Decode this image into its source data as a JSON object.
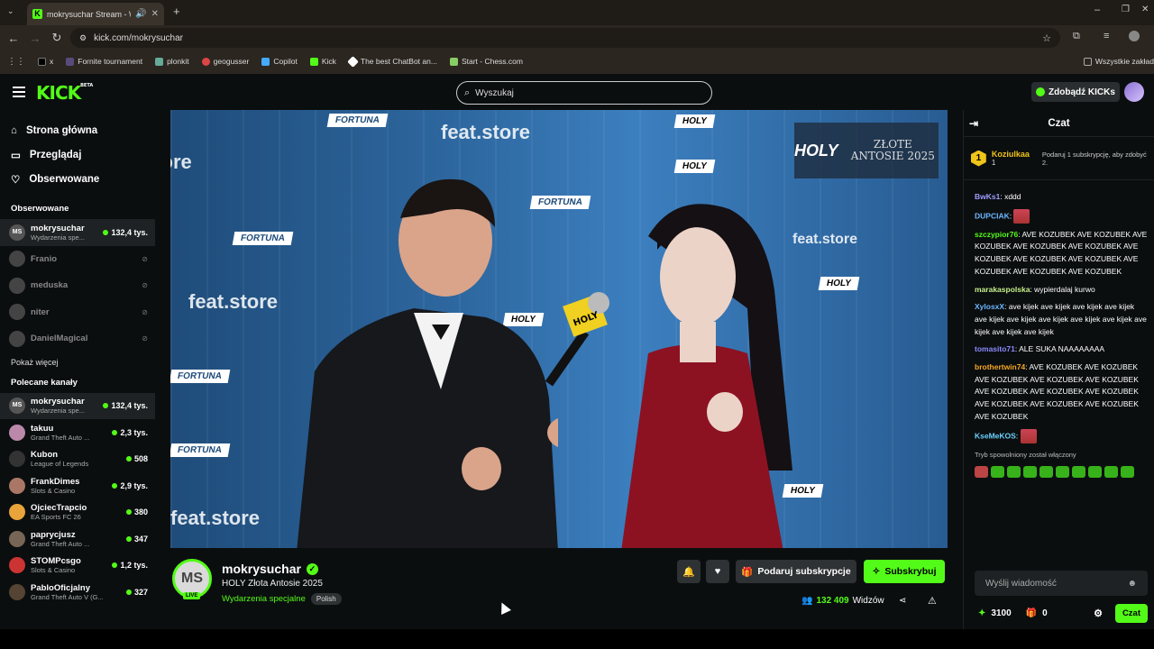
{
  "browser": {
    "tab_title": "mokrysuchar Stream - Wat",
    "url": "kick.com/mokrysuchar",
    "bookmarks": [
      "x",
      "Fornite tournament",
      "plonkit",
      "geogusser",
      "Copilot",
      "Kick",
      "The best ChatBot an...",
      "Start - Chess.com"
    ],
    "bookmarks_other": "Wszystkie zakład"
  },
  "header": {
    "logo": "KICK",
    "logo_beta": "BETA",
    "search_placeholder": "Wyszukaj",
    "kicks_button": "Zdobądź KICKs"
  },
  "sidebar": {
    "nav": [
      "Strona główna",
      "Przeglądaj",
      "Obserwowane"
    ],
    "followed_title": "Obserwowane",
    "followed": [
      {
        "name": "mokrysuchar",
        "category": "Wydarzenia spe...",
        "viewers": "132,4 tys.",
        "live": true
      },
      {
        "name": "Franio",
        "live": false
      },
      {
        "name": "meduska",
        "live": false
      },
      {
        "name": "niter",
        "live": false
      },
      {
        "name": "DanielMagical",
        "live": false
      }
    ],
    "show_more": "Pokaż więcej",
    "recommended_title": "Polecane kanały",
    "recommended": [
      {
        "name": "mokrysuchar",
        "category": "Wydarzenia spe...",
        "viewers": "132,4 tys."
      },
      {
        "name": "takuu",
        "category": "Grand Theft Auto ...",
        "viewers": "2,3 tys."
      },
      {
        "name": "Kubon",
        "category": "League of Legends",
        "viewers": "508"
      },
      {
        "name": "FrankDimes",
        "category": "Slots & Casino",
        "viewers": "2,9 tys."
      },
      {
        "name": "OjciecTrapcio",
        "category": "EA Sports FC 26",
        "viewers": "380"
      },
      {
        "name": "paprycjusz",
        "category": "Grand Theft Auto ...",
        "viewers": "347"
      },
      {
        "name": "STOMPcsgo",
        "category": "Slots & Casino",
        "viewers": "1,2 tys."
      },
      {
        "name": "PabloOficjalny",
        "category": "Grand Theft Auto V (G...",
        "viewers": "327"
      }
    ]
  },
  "player": {
    "overlay_brand": "HOLY",
    "overlay_event": "ZŁOTE ANTOSIE 2025",
    "mic_label": "HOLY"
  },
  "stream": {
    "avatar_initials": "MS",
    "live_label": "LIVE",
    "username": "mokrysuchar",
    "title": "HOLY Złota Antosie 2025",
    "category": "Wydarzenia specjalne",
    "language": "Polish",
    "gift_button": "Podaruj subskrypcje",
    "subscribe_button": "Subskrybuj",
    "viewers": "132 409",
    "viewers_label": "Widzów"
  },
  "chat": {
    "title": "Czat",
    "pinned": {
      "rank": "1",
      "user": "Koziulkaa",
      "count": "1",
      "message": "Podaruj 1 subskrypcję, aby zdobyć 2."
    },
    "messages": [
      {
        "user": "BwKs1",
        "color": "#9f9cff",
        "text": "xddd"
      },
      {
        "user": "DUPCIAK",
        "color": "#6ab7ff",
        "text": ""
      },
      {
        "user": "szczypior76",
        "color": "#53fc18",
        "text": "AVE KOZUBEK  AVE KOZUBEK  AVE KOZUBEK  AVE KOZUBEK  AVE KOZUBEK  AVE KOZUBEK  AVE KOZUBEK  AVE KOZUBEK  AVE KOZUBEK  AVE KOZUBEK  AVE KOZUBEK"
      },
      {
        "user": "marakaspolska",
        "color": "#c5f08a",
        "text": "wypierdalaj kurwo"
      },
      {
        "user": "XylosxX",
        "color": "#6ab7ff",
        "text": "ave kijek  ave kijek  ave kijek  ave kijek  ave kijek  ave kijek  ave kijek  ave kijek  ave kijek  ave kijek  ave kijek  ave kijek"
      },
      {
        "user": "tomasito71",
        "color": "#8a8aff",
        "text": "ALE SUKA NAAAAAAAA"
      },
      {
        "user": "brothertwin74",
        "color": "#f5a623",
        "text": "AVE KOZUBEK  AVE KOZUBEK  AVE KOZUBEK  AVE KOZUBEK  AVE KOZUBEK  AVE KOZUBEK  AVE KOZUBEK  AVE KOZUBEK  AVE KOZUBEK  AVE KOZUBEK  AVE KOZUBEK  AVE KOZUBEK"
      },
      {
        "user": "KseMeKOS",
        "color": "#6ad1ff",
        "text": ""
      }
    ],
    "slow_mode": "Tryb spowolniony został włączony",
    "input_placeholder": "Wyślij wiadomość",
    "points": "3100",
    "count2": "0",
    "send_button": "Czat"
  }
}
